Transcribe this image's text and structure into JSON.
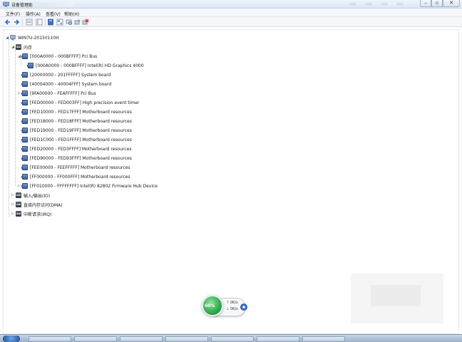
{
  "window": {
    "title": "设备管理器"
  },
  "menu": [
    {
      "label": "文件(F)"
    },
    {
      "label": "操作(A)"
    },
    {
      "label": "查看(V)"
    },
    {
      "label": "帮助(H)"
    }
  ],
  "toolbar": [
    {
      "icon": "back-arrow-icon"
    },
    {
      "icon": "forward-arrow-icon"
    },
    {
      "icon": "properties-view-icon"
    },
    {
      "icon": "list-view-icon"
    },
    {
      "icon": "help-book-icon"
    },
    {
      "icon": "grid-view-icon"
    },
    {
      "icon": "scan-hardware-icon"
    },
    {
      "icon": "update-driver-icon"
    },
    {
      "icon": "uninstall-icon"
    }
  ],
  "tree": {
    "root": "WIN7U-20150110H",
    "memory": "内存",
    "items": [
      {
        "label": "[000A0000 - 000BFFFF]  Pci Bus",
        "expanded": true
      },
      {
        "label": "[000A0000 - 000BFFFF]  Intel(R) HD Graphics 4000"
      },
      {
        "label": "[20000000 - 201FFFFF]  System board"
      },
      {
        "label": "[40004000 - 40004FFF]  System board"
      },
      {
        "label": "[9FA00000 - FEAFFFFF]  Pci Bus"
      },
      {
        "label": "[FED00000 - FED003FF]  High precision event timer"
      },
      {
        "label": "[FED10000 - FED17FFF]  Motherboard resources"
      },
      {
        "label": "[FED18000 - FED18FFF]  Motherboard resources"
      },
      {
        "label": "[FED19000 - FED19FFF]  Motherboard resources"
      },
      {
        "label": "[FED1C000 - FED1FFFF]  Motherboard resources"
      },
      {
        "label": "[FED20000 - FED3FFFF]  Motherboard resources"
      },
      {
        "label": "[FED90000 - FED93FFF]  Motherboard resources"
      },
      {
        "label": "[FEE00000 - FEEFFFFF]  Motherboard resources"
      },
      {
        "label": "[FF000000 - FF000FFF]  Motherboard resources"
      },
      {
        "label": "[FF010000 - FFFFFFFF]  Intel(R) 82802 Firmware Hub Device"
      }
    ],
    "siblings": [
      {
        "label": "输入/输出(IO)"
      },
      {
        "label": "直接内存访问(DMA)"
      },
      {
        "label": "中断请求(IRQ)"
      }
    ]
  },
  "net_widget": {
    "percent": "60%",
    "upload": "0K/s",
    "download": "0K/s",
    "ball_color": "#2fa84a"
  }
}
